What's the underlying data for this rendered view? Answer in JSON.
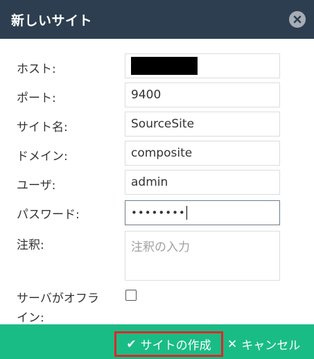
{
  "dialog": {
    "title": "新しいサイト",
    "close_icon": "close-circle-icon"
  },
  "form": {
    "host": {
      "label": "ホスト:",
      "value": ""
    },
    "port": {
      "label": "ポート:",
      "value": "9400"
    },
    "site_name": {
      "label": "サイト名:",
      "value": "SourceSite"
    },
    "domain": {
      "label": "ドメイン:",
      "value": "composite"
    },
    "user": {
      "label": "ユーザ:",
      "value": "admin"
    },
    "password": {
      "label": "パスワード:",
      "value": "••••••••"
    },
    "comment": {
      "label": "注釈:",
      "placeholder": "注釈の入力"
    },
    "server_offline": {
      "label_line1": "サーバがオフラ",
      "label_line2": "イン:",
      "checked": false
    }
  },
  "footer": {
    "create_label": "サイトの作成",
    "create_icon": "check-icon",
    "cancel_label": "キャンセル",
    "cancel_icon": "x-icon"
  },
  "colors": {
    "titlebar": "#2d3e50",
    "footer": "#1abc85",
    "highlight": "#e0262a"
  }
}
